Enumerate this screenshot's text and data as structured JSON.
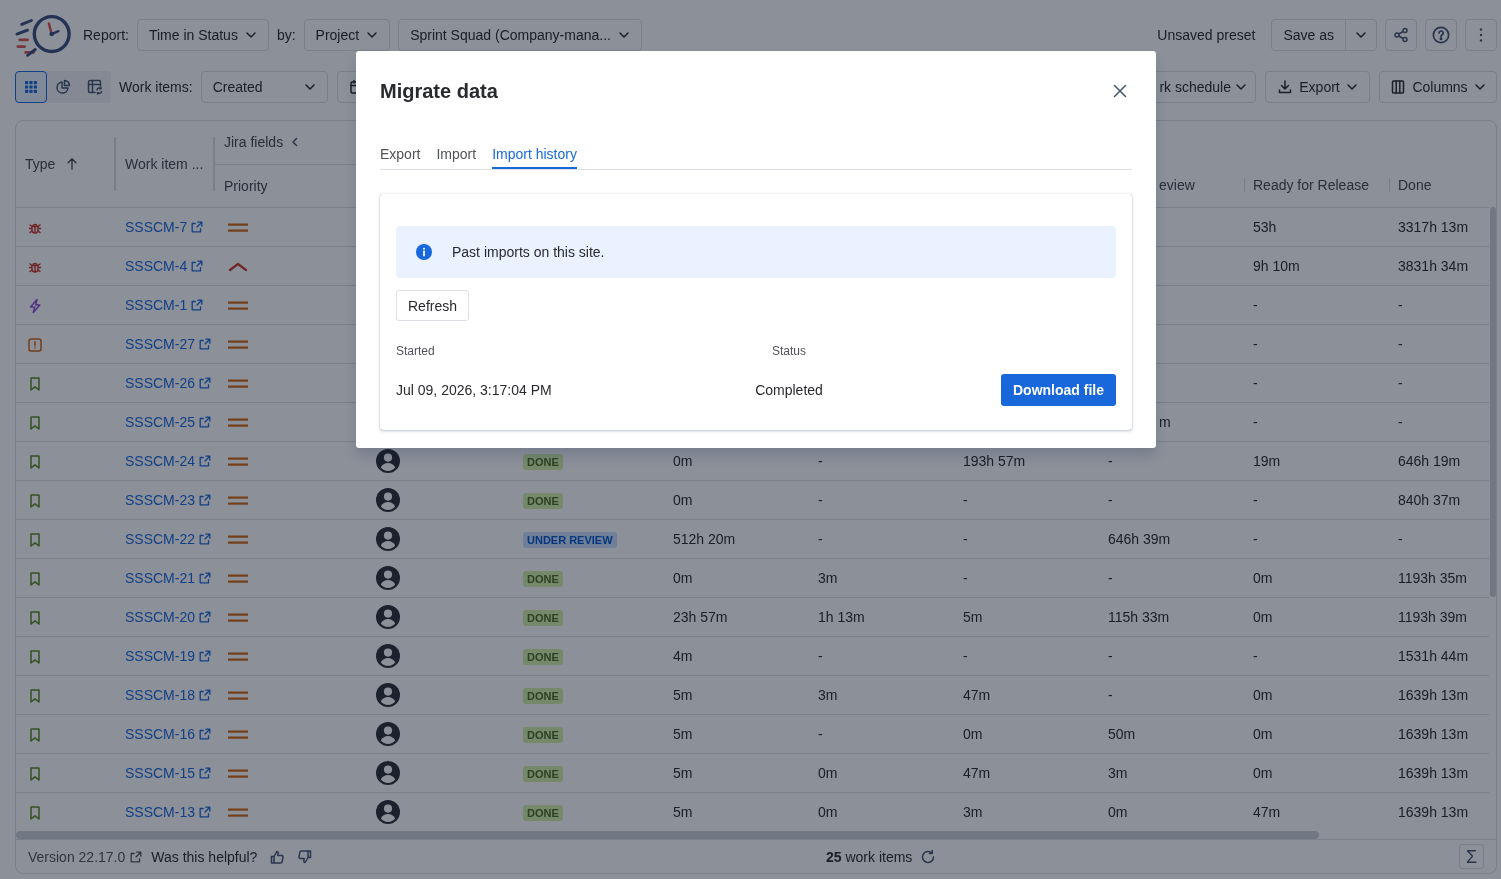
{
  "toolbar": {
    "report_label": "Report:",
    "report": "Time in Status",
    "by_label": "by:",
    "group_by": "Project",
    "project": "Sprint Squad (Company-mana...",
    "preset": "Unsaved preset",
    "save_button": "Save as"
  },
  "filters": {
    "views": [
      {
        "kind": "grid",
        "selected": true
      },
      {
        "kind": "pie",
        "selected": false
      },
      {
        "kind": "table",
        "selected": false
      }
    ],
    "work_items_label": "Work items:",
    "work_items": "Created",
    "schedule_button": "rk schedule",
    "export_button": "Export",
    "columns_button": "Columns"
  },
  "table": {
    "columns": [
      {
        "label": "Type",
        "sorted_ascending": true
      },
      {
        "label": "Work item ..."
      }
    ],
    "group": {
      "label": "Jira fields",
      "columns": [
        {
          "label": "Priority"
        }
      ]
    },
    "time_columns": [
      {
        "label": "eview"
      },
      {
        "label": "Ready for Release"
      },
      {
        "label": "Done"
      }
    ],
    "rows": [
      {
        "kind": "bug",
        "key": "SSSCM-7",
        "high_priority": false,
        "times": [
          "53h",
          "3317h 13m"
        ]
      },
      {
        "kind": "bug",
        "key": "SSSCM-4",
        "high_priority": true,
        "times": [
          "9h 10m",
          "3831h 34m"
        ]
      },
      {
        "kind": "lightning",
        "key": "SSSCM-1",
        "high_priority": false,
        "times": [
          "-",
          "-"
        ]
      },
      {
        "kind": "exclamation",
        "key": "SSSCM-27",
        "high_priority": false,
        "times": [
          "-",
          "-"
        ]
      },
      {
        "kind": "bookmark",
        "key": "SSSCM-26",
        "high_priority": false,
        "times": [
          "-",
          "-"
        ]
      },
      {
        "kind": "bookmark",
        "key": "SSSCM-25",
        "high_priority": false,
        "times": [
          "m",
          "-",
          "-"
        ]
      },
      {
        "kind": "bookmark",
        "key": "SSSCM-24",
        "high_priority": false,
        "avatar": true,
        "status": {
          "label": "DONE",
          "kind": "done"
        },
        "times": [
          "0m",
          "-",
          "193h 57m",
          "-",
          "19m",
          "646h 19m"
        ]
      },
      {
        "kind": "bookmark",
        "key": "SSSCM-23",
        "high_priority": false,
        "avatar": true,
        "status": {
          "label": "DONE",
          "kind": "done"
        },
        "times": [
          "0m",
          "-",
          "-",
          "-",
          "-",
          "840h 37m"
        ]
      },
      {
        "kind": "bookmark",
        "key": "SSSCM-22",
        "high_priority": false,
        "avatar": true,
        "status": {
          "label": "UNDER REVIEW",
          "kind": "review"
        },
        "times": [
          "512h 20m",
          "-",
          "-",
          "646h 39m",
          "-",
          "-"
        ]
      },
      {
        "kind": "bookmark",
        "key": "SSSCM-21",
        "high_priority": false,
        "avatar": true,
        "status": {
          "label": "DONE",
          "kind": "done"
        },
        "times": [
          "0m",
          "3m",
          "-",
          "-",
          "0m",
          "1193h 35m"
        ]
      },
      {
        "kind": "bookmark",
        "key": "SSSCM-20",
        "high_priority": false,
        "avatar": true,
        "status": {
          "label": "DONE",
          "kind": "done"
        },
        "times": [
          "23h 57m",
          "1h 13m",
          "5m",
          "115h 33m",
          "0m",
          "1193h 39m"
        ]
      },
      {
        "kind": "bookmark",
        "key": "SSSCM-19",
        "high_priority": false,
        "avatar": true,
        "status": {
          "label": "DONE",
          "kind": "done"
        },
        "times": [
          "4m",
          "-",
          "-",
          "-",
          "-",
          "1531h 44m"
        ]
      },
      {
        "kind": "bookmark",
        "key": "SSSCM-18",
        "high_priority": false,
        "avatar": true,
        "status": {
          "label": "DONE",
          "kind": "done"
        },
        "times": [
          "5m",
          "3m",
          "47m",
          "-",
          "0m",
          "1639h 13m"
        ]
      },
      {
        "kind": "bookmark",
        "key": "SSSCM-16",
        "high_priority": false,
        "avatar": true,
        "status": {
          "label": "DONE",
          "kind": "done"
        },
        "times": [
          "5m",
          "-",
          "0m",
          "50m",
          "0m",
          "1639h 13m"
        ]
      },
      {
        "kind": "bookmark",
        "key": "SSSCM-15",
        "high_priority": false,
        "avatar": true,
        "status": {
          "label": "DONE",
          "kind": "done"
        },
        "times": [
          "5m",
          "0m",
          "47m",
          "3m",
          "0m",
          "1639h 13m"
        ]
      },
      {
        "kind": "bookmark",
        "key": "SSSCM-13",
        "high_priority": false,
        "avatar": true,
        "status": {
          "label": "DONE",
          "kind": "done"
        },
        "times": [
          "5m",
          "0m",
          "3m",
          "0m",
          "47m",
          "1639h 13m"
        ]
      }
    ]
  },
  "footer": {
    "version": "Version 22.17.0",
    "feedback": "Was this helpful?",
    "count": "**25** work items",
    "sum_button": "Σ"
  },
  "modal": {
    "title": "Migrate data",
    "tabs": [
      {
        "label": "Export",
        "selected": false
      },
      {
        "label": "Import",
        "selected": false
      },
      {
        "label": "Import history",
        "selected": true
      }
    ],
    "info": "Past imports on this site.",
    "refresh_button": "Refresh",
    "columns": [
      "Started",
      "Status"
    ],
    "imports": [
      {
        "started": "Jul 09, 2026, 3:17:04 PM",
        "status": "Completed",
        "action": "Download file"
      }
    ]
  }
}
